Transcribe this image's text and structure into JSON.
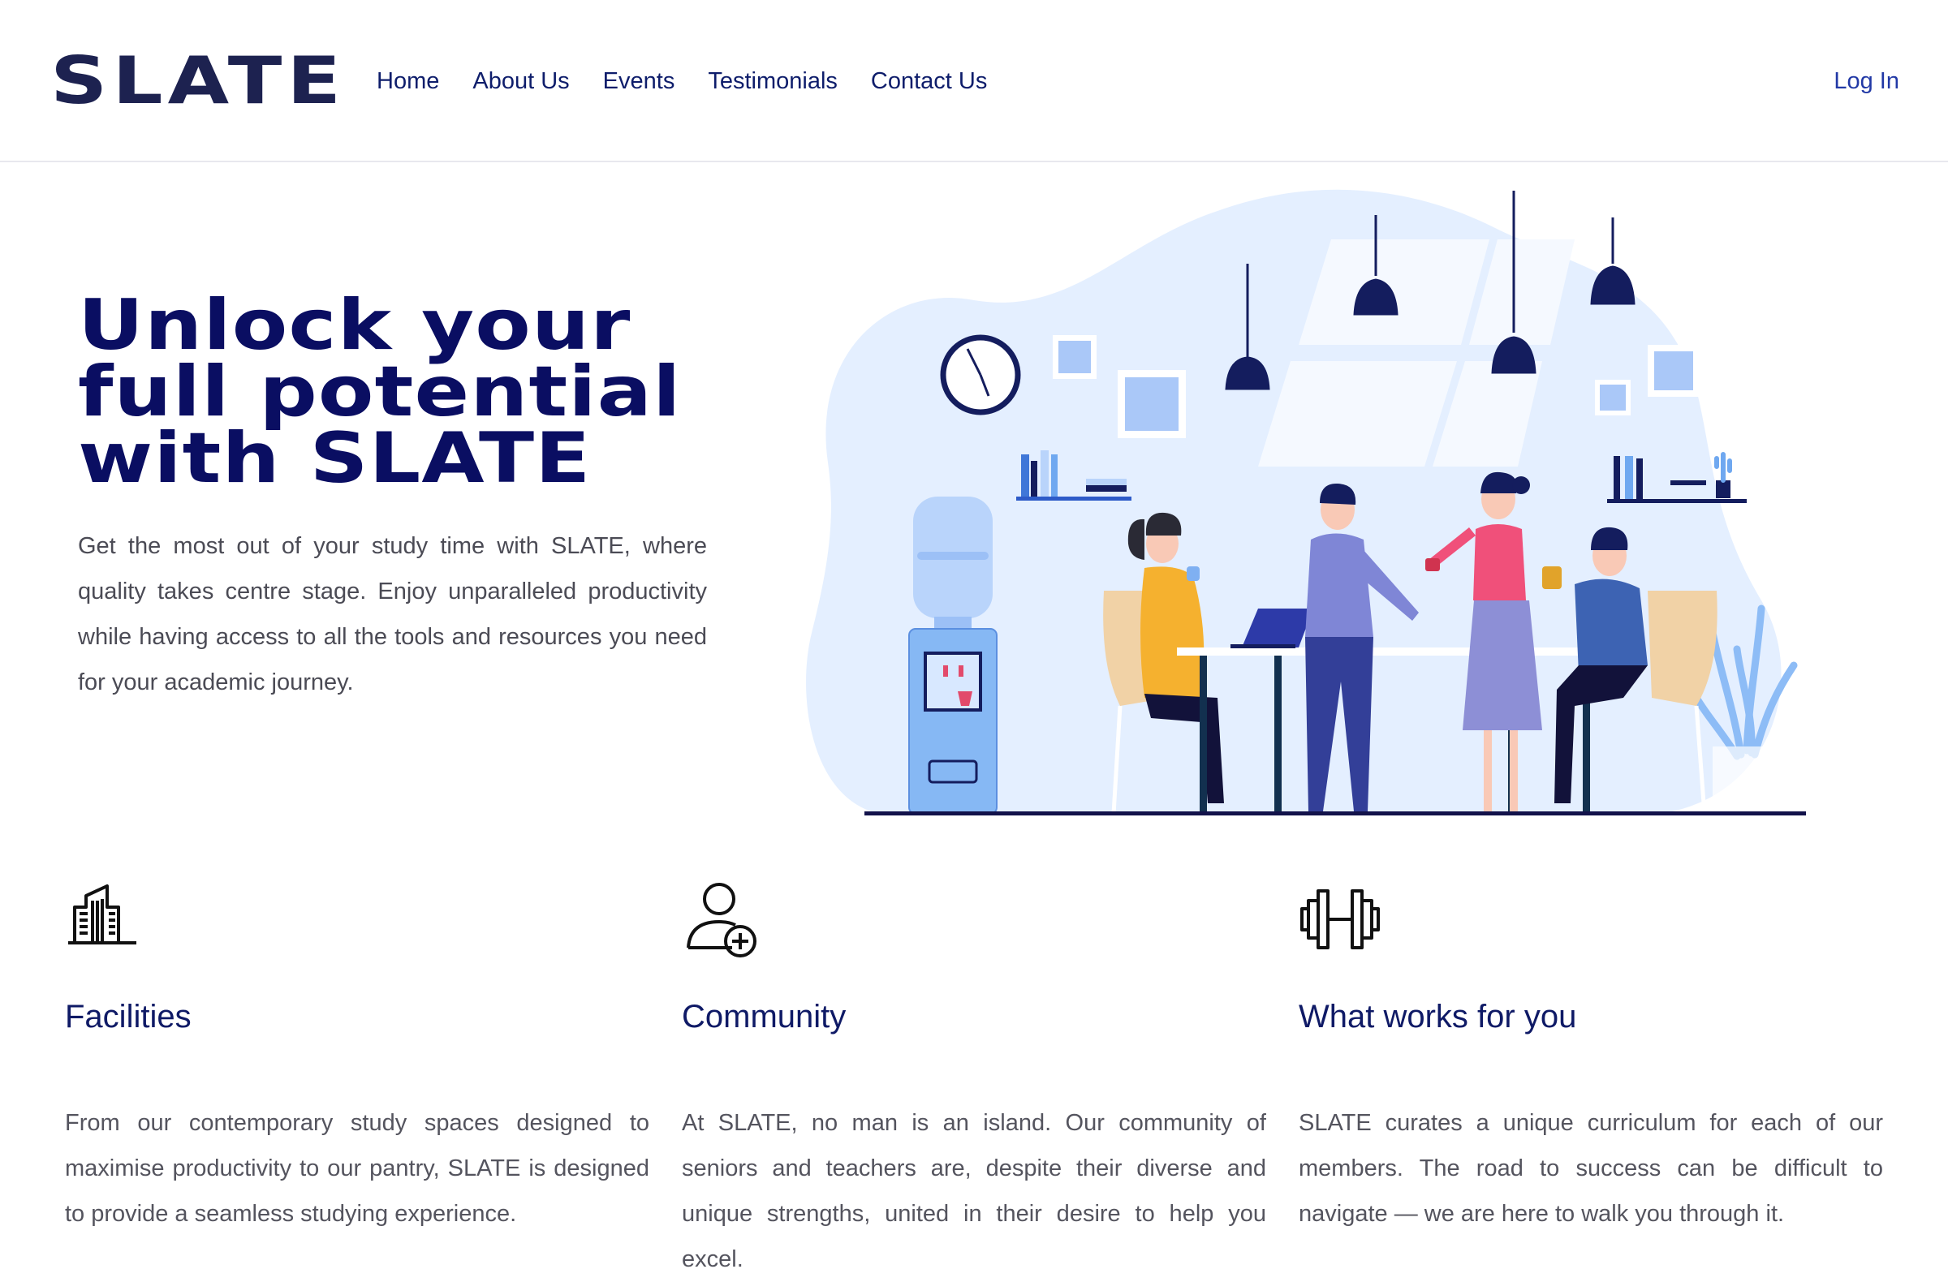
{
  "brand": {
    "logo": "SLATE"
  },
  "nav": {
    "items": [
      {
        "label": "Home"
      },
      {
        "label": "About Us"
      },
      {
        "label": "Events"
      },
      {
        "label": "Testimonials"
      },
      {
        "label": "Contact Us"
      }
    ],
    "login_label": "Log In"
  },
  "hero": {
    "title_lines": [
      "Unlock your",
      "full potential",
      "with SLATE"
    ],
    "text": "Get the most out of your study time with SLATE, where quality takes centre stage. Enjoy unparalleled productivity while having access to all the tools and resources you need for your academic journey.",
    "illustration": "office-team-meeting-illustration"
  },
  "features": [
    {
      "icon": "building-icon",
      "title": "Facilities",
      "text": "From our contemporary study spaces designed to maximise productivity to our pantry, SLATE is designed to provide a seamless studying experience."
    },
    {
      "icon": "user-add-icon",
      "title": "Community",
      "text": "At SLATE, no man is an island. Our community of seniors and teachers are, despite their diverse and unique strengths, united in their desire to help you excel."
    },
    {
      "icon": "dumbbell-icon",
      "title": "What works for you",
      "text": "SLATE curates a unique curriculum for each of our members. The road to success can be difficult to navigate — we are here to walk you through it."
    }
  ],
  "colors": {
    "brand_navy": "#0a0e62",
    "link_blue": "#2239a6",
    "illustration_blob": "#e4efff",
    "body_text": "#4b4b55"
  }
}
